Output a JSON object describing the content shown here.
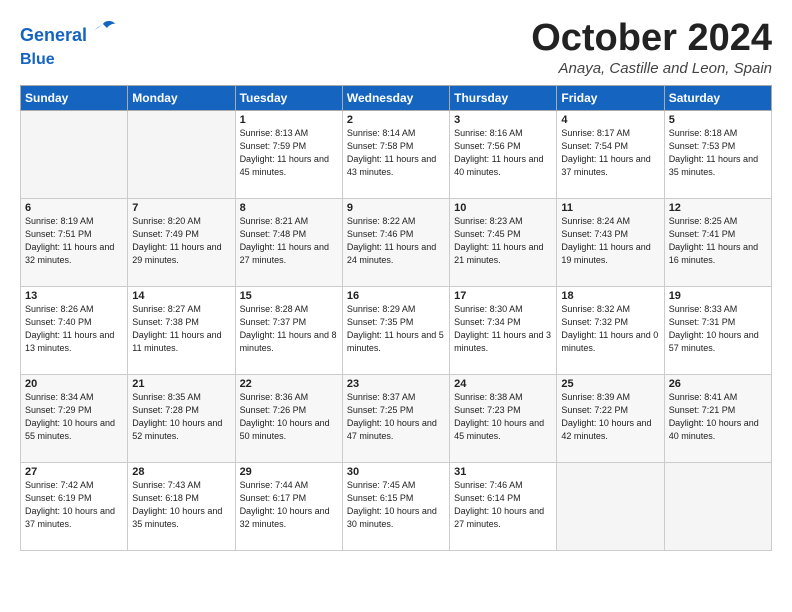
{
  "logo": {
    "text1": "General",
    "text2": "Blue"
  },
  "title": "October 2024",
  "subtitle": "Anaya, Castille and Leon, Spain",
  "days_header": [
    "Sunday",
    "Monday",
    "Tuesday",
    "Wednesday",
    "Thursday",
    "Friday",
    "Saturday"
  ],
  "weeks": [
    [
      {
        "day": "",
        "detail": ""
      },
      {
        "day": "",
        "detail": ""
      },
      {
        "day": "1",
        "detail": "Sunrise: 8:13 AM\nSunset: 7:59 PM\nDaylight: 11 hours and 45 minutes."
      },
      {
        "day": "2",
        "detail": "Sunrise: 8:14 AM\nSunset: 7:58 PM\nDaylight: 11 hours and 43 minutes."
      },
      {
        "day": "3",
        "detail": "Sunrise: 8:16 AM\nSunset: 7:56 PM\nDaylight: 11 hours and 40 minutes."
      },
      {
        "day": "4",
        "detail": "Sunrise: 8:17 AM\nSunset: 7:54 PM\nDaylight: 11 hours and 37 minutes."
      },
      {
        "day": "5",
        "detail": "Sunrise: 8:18 AM\nSunset: 7:53 PM\nDaylight: 11 hours and 35 minutes."
      }
    ],
    [
      {
        "day": "6",
        "detail": "Sunrise: 8:19 AM\nSunset: 7:51 PM\nDaylight: 11 hours and 32 minutes."
      },
      {
        "day": "7",
        "detail": "Sunrise: 8:20 AM\nSunset: 7:49 PM\nDaylight: 11 hours and 29 minutes."
      },
      {
        "day": "8",
        "detail": "Sunrise: 8:21 AM\nSunset: 7:48 PM\nDaylight: 11 hours and 27 minutes."
      },
      {
        "day": "9",
        "detail": "Sunrise: 8:22 AM\nSunset: 7:46 PM\nDaylight: 11 hours and 24 minutes."
      },
      {
        "day": "10",
        "detail": "Sunrise: 8:23 AM\nSunset: 7:45 PM\nDaylight: 11 hours and 21 minutes."
      },
      {
        "day": "11",
        "detail": "Sunrise: 8:24 AM\nSunset: 7:43 PM\nDaylight: 11 hours and 19 minutes."
      },
      {
        "day": "12",
        "detail": "Sunrise: 8:25 AM\nSunset: 7:41 PM\nDaylight: 11 hours and 16 minutes."
      }
    ],
    [
      {
        "day": "13",
        "detail": "Sunrise: 8:26 AM\nSunset: 7:40 PM\nDaylight: 11 hours and 13 minutes."
      },
      {
        "day": "14",
        "detail": "Sunrise: 8:27 AM\nSunset: 7:38 PM\nDaylight: 11 hours and 11 minutes."
      },
      {
        "day": "15",
        "detail": "Sunrise: 8:28 AM\nSunset: 7:37 PM\nDaylight: 11 hours and 8 minutes."
      },
      {
        "day": "16",
        "detail": "Sunrise: 8:29 AM\nSunset: 7:35 PM\nDaylight: 11 hours and 5 minutes."
      },
      {
        "day": "17",
        "detail": "Sunrise: 8:30 AM\nSunset: 7:34 PM\nDaylight: 11 hours and 3 minutes."
      },
      {
        "day": "18",
        "detail": "Sunrise: 8:32 AM\nSunset: 7:32 PM\nDaylight: 11 hours and 0 minutes."
      },
      {
        "day": "19",
        "detail": "Sunrise: 8:33 AM\nSunset: 7:31 PM\nDaylight: 10 hours and 57 minutes."
      }
    ],
    [
      {
        "day": "20",
        "detail": "Sunrise: 8:34 AM\nSunset: 7:29 PM\nDaylight: 10 hours and 55 minutes."
      },
      {
        "day": "21",
        "detail": "Sunrise: 8:35 AM\nSunset: 7:28 PM\nDaylight: 10 hours and 52 minutes."
      },
      {
        "day": "22",
        "detail": "Sunrise: 8:36 AM\nSunset: 7:26 PM\nDaylight: 10 hours and 50 minutes."
      },
      {
        "day": "23",
        "detail": "Sunrise: 8:37 AM\nSunset: 7:25 PM\nDaylight: 10 hours and 47 minutes."
      },
      {
        "day": "24",
        "detail": "Sunrise: 8:38 AM\nSunset: 7:23 PM\nDaylight: 10 hours and 45 minutes."
      },
      {
        "day": "25",
        "detail": "Sunrise: 8:39 AM\nSunset: 7:22 PM\nDaylight: 10 hours and 42 minutes."
      },
      {
        "day": "26",
        "detail": "Sunrise: 8:41 AM\nSunset: 7:21 PM\nDaylight: 10 hours and 40 minutes."
      }
    ],
    [
      {
        "day": "27",
        "detail": "Sunrise: 7:42 AM\nSunset: 6:19 PM\nDaylight: 10 hours and 37 minutes."
      },
      {
        "day": "28",
        "detail": "Sunrise: 7:43 AM\nSunset: 6:18 PM\nDaylight: 10 hours and 35 minutes."
      },
      {
        "day": "29",
        "detail": "Sunrise: 7:44 AM\nSunset: 6:17 PM\nDaylight: 10 hours and 32 minutes."
      },
      {
        "day": "30",
        "detail": "Sunrise: 7:45 AM\nSunset: 6:15 PM\nDaylight: 10 hours and 30 minutes."
      },
      {
        "day": "31",
        "detail": "Sunrise: 7:46 AM\nSunset: 6:14 PM\nDaylight: 10 hours and 27 minutes."
      },
      {
        "day": "",
        "detail": ""
      },
      {
        "day": "",
        "detail": ""
      }
    ]
  ]
}
